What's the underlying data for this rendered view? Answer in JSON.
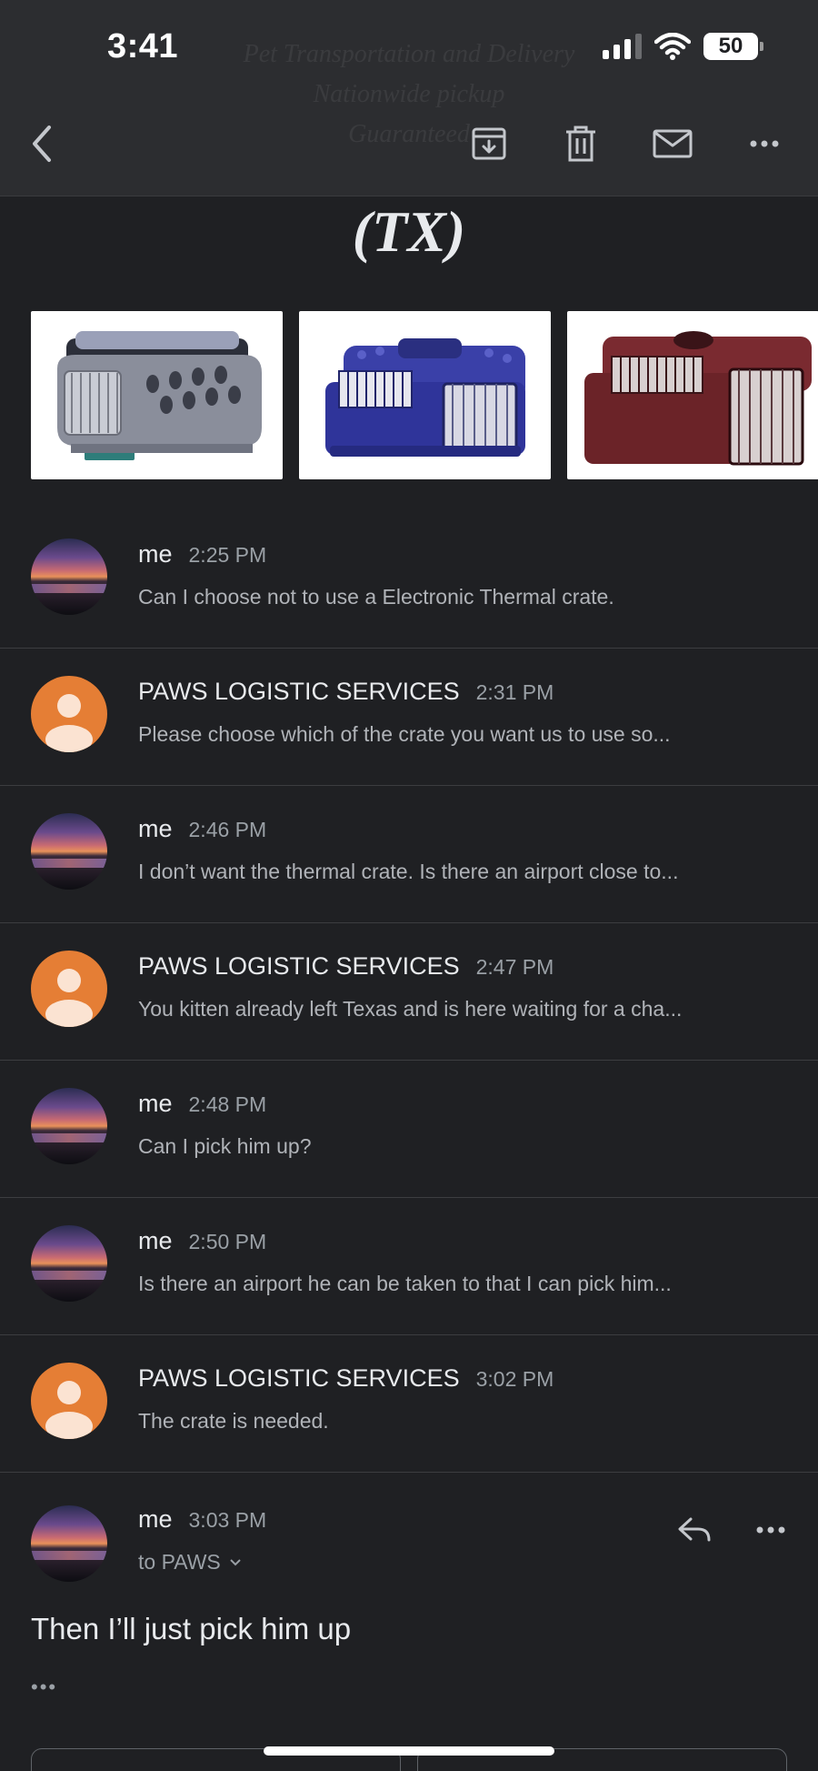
{
  "status_bar": {
    "time": "3:41",
    "battery": "50"
  },
  "header": {
    "ghost_lines": [
      "Pet Transportation and Delivery",
      "Nationwide pickup",
      "Guaranteed"
    ],
    "icons": [
      "back-icon",
      "archive-icon",
      "trash-icon",
      "mail-icon",
      "more-icon"
    ]
  },
  "banner": {
    "title": "(TX)"
  },
  "crates": [
    {
      "name": "Electronic thermal crate",
      "color": "#8a8e9b"
    },
    {
      "name": "Blue pet crate",
      "color": "#3a40a8"
    },
    {
      "name": "Burgundy pet crate",
      "color": "#6b2328"
    }
  ],
  "messages": [
    {
      "sender": "me",
      "time": "2:25 PM",
      "snippet": "Can I choose not to use a Electronic Thermal crate.",
      "avatar": "photo"
    },
    {
      "sender": "PAWS LOGISTIC SERVICES",
      "time": "2:31 PM",
      "snippet": "Please choose which of the crate you want us to use so...",
      "avatar": "person"
    },
    {
      "sender": "me",
      "time": "2:46 PM",
      "snippet": "I don’t want the thermal crate. Is there an airport close to...",
      "avatar": "photo"
    },
    {
      "sender": "PAWS LOGISTIC SERVICES",
      "time": "2:47 PM",
      "snippet": "You kitten already left Texas and is here waiting for a cha...",
      "avatar": "person"
    },
    {
      "sender": "me",
      "time": "2:48 PM",
      "snippet": "Can I pick him up?",
      "avatar": "photo"
    },
    {
      "sender": "me",
      "time": "2:50 PM",
      "snippet": "Is there an airport he can be taken to that I can pick him...",
      "avatar": "photo"
    },
    {
      "sender": "PAWS LOGISTIC SERVICES",
      "time": "3:02 PM",
      "snippet": "The crate is needed.",
      "avatar": "person"
    }
  ],
  "expanded": {
    "sender": "me",
    "time": "3:03 PM",
    "to": "to PAWS",
    "body": "Then I’ll just pick him up",
    "trimmed": "•••"
  },
  "colors": {
    "accent_orange": "#e57e35",
    "background": "#1f2023",
    "header": "#2c2d30"
  }
}
